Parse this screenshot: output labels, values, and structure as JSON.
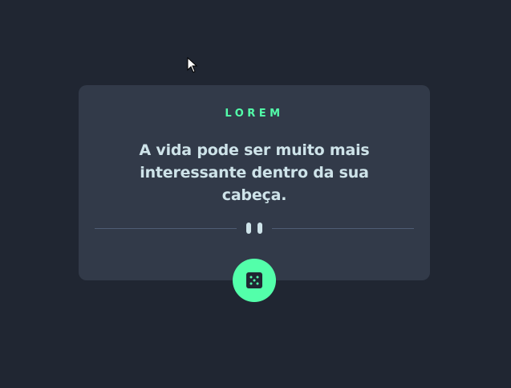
{
  "advice": {
    "label": "LOREM",
    "quote": "A vida pode ser muito mais interessante dentro da sua cabeça."
  },
  "icons": {
    "cursor": "mouse-pointer-icon",
    "divider": "pause-icon",
    "button": "dice-icon"
  },
  "colors": {
    "background": "#202632",
    "card": "#323a49",
    "accent": "#53ffaa",
    "text": "#cee3e9",
    "divider": "#4f5d74"
  }
}
